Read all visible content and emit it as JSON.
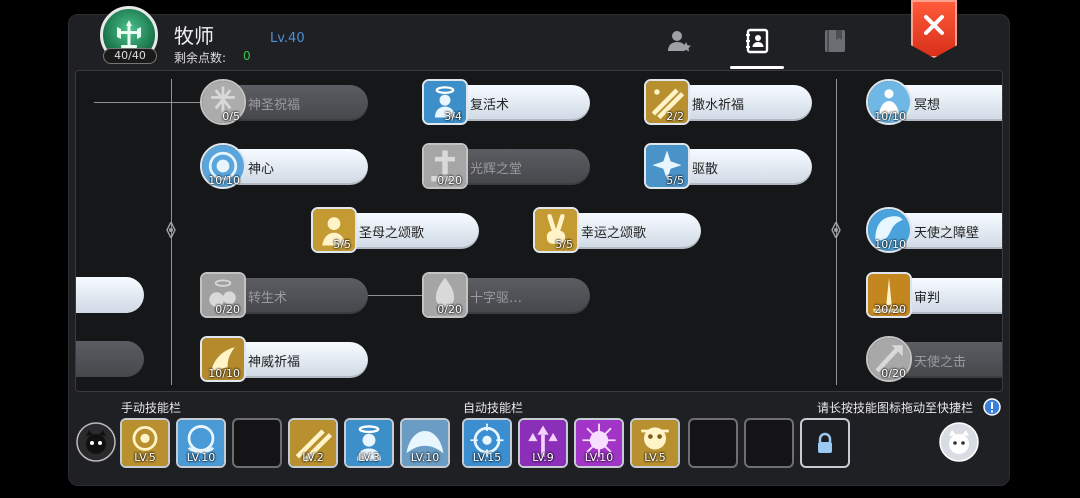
{
  "header": {
    "class_name": "牧师",
    "level": "Lv.40",
    "points_label": "剩余点数:",
    "points_value": "0",
    "emblem_count": "40/40",
    "tabs": [
      {
        "name": "profile-tab",
        "icon": "user-star-icon",
        "active": false
      },
      {
        "name": "skills-tab",
        "icon": "skill-book-icon",
        "active": true
      },
      {
        "name": "codex-tab",
        "icon": "bookmark-book-icon",
        "active": false
      }
    ],
    "close_icon": "close-icon"
  },
  "skill_tree": {
    "skills": [
      {
        "id": "holy-blessing",
        "name": "神圣祝福",
        "count": "0/5",
        "locked": true
      },
      {
        "id": "resurrection",
        "name": "复活术",
        "count": "3/4",
        "locked": false
      },
      {
        "id": "sprinkle-blessing",
        "name": "撒水祈福",
        "count": "2/2",
        "locked": false
      },
      {
        "id": "meditation",
        "name": "冥想",
        "count": "10/10",
        "locked": false
      },
      {
        "id": "divine-heart",
        "name": "神心",
        "count": "10/10",
        "locked": false
      },
      {
        "id": "hall-of-light",
        "name": "光辉之堂",
        "count": "0/20",
        "locked": true
      },
      {
        "id": "dispel",
        "name": "驱散",
        "count": "5/5",
        "locked": false
      },
      {
        "id": "hymn-of-mother",
        "name": "圣母之颂歌",
        "count": "5/5",
        "locked": false
      },
      {
        "id": "hymn-of-luck",
        "name": "幸运之颂歌",
        "count": "5/5",
        "locked": false
      },
      {
        "id": "angel-barrier",
        "name": "天使之障壁",
        "count": "10/10",
        "locked": false
      },
      {
        "id": "rebirth",
        "name": "转生术",
        "count": "0/20",
        "locked": true
      },
      {
        "id": "cross-exorcism",
        "name": "十字驱…",
        "count": "0/20",
        "locked": true
      },
      {
        "id": "judgement",
        "name": "审判",
        "count": "20/20",
        "locked": false
      },
      {
        "id": "divine-prayer",
        "name": "神威祈福",
        "count": "10/10",
        "locked": false
      },
      {
        "id": "angel-strike",
        "name": "天使之击",
        "count": "0/20",
        "locked": true
      }
    ]
  },
  "manual_bar": {
    "title": "手动技能栏",
    "slots": [
      {
        "lv": "LV.5",
        "icon": "divine-prayer-icon"
      },
      {
        "lv": "LV.10",
        "icon": "divine-heart-icon"
      },
      {
        "lv": "",
        "icon": ""
      },
      {
        "lv": "LV.2",
        "icon": "sprinkle-blessing-icon"
      },
      {
        "lv": "LV.3",
        "icon": "resurrection-icon"
      },
      {
        "lv": "LV.10",
        "icon": "angel-wings-icon"
      }
    ]
  },
  "auto_bar": {
    "title": "自动技能栏",
    "slots": [
      {
        "lv": "LV.15",
        "icon": "target-icon"
      },
      {
        "lv": "LV.9",
        "icon": "purple-arrows-icon"
      },
      {
        "lv": "LV.10",
        "icon": "purple-burst-icon"
      },
      {
        "lv": "LV.5",
        "icon": "golden-mask-icon"
      },
      {
        "lv": "",
        "icon": ""
      },
      {
        "lv": "",
        "icon": ""
      }
    ]
  },
  "hint": "请长按技能图标拖动至快捷栏",
  "colors": {
    "accent_blue": "#4f8fd6",
    "points_green": "#37c24c",
    "close_red": "#e23b22"
  }
}
